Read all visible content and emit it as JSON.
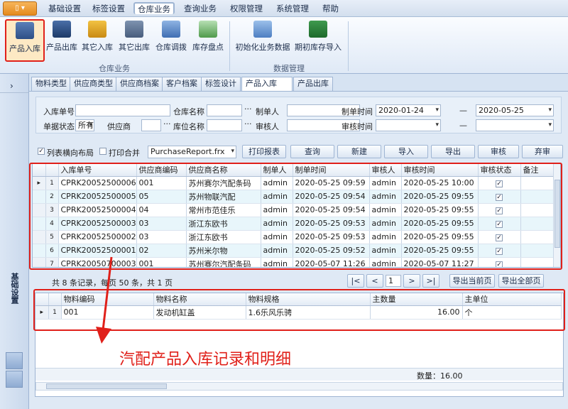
{
  "app_menu_label": "▯ ▾",
  "menu": [
    "基础设置",
    "标签设置",
    "仓库业务",
    "查询业务",
    "权限管理",
    "系统管理",
    "帮助"
  ],
  "ribbon": {
    "warehouse_buttons": [
      "产品入库",
      "产品出库",
      "其它入库",
      "其它出库",
      "仓库调拨",
      "库存盘点"
    ],
    "warehouse_group": "仓库业务",
    "data_buttons": [
      "初始化业务数据",
      "期初库存导入"
    ],
    "data_group": "数据管理"
  },
  "left_panel": {
    "label": "基础设置",
    "toggle": "›"
  },
  "tabs": [
    "物料类型",
    "供应商类型",
    "供应商档案",
    "客户档案",
    "标签设计",
    "产品入库",
    "产品出库"
  ],
  "tab_close": "✕",
  "form": {
    "in_no_label": "入库单号",
    "in_no_value": "",
    "wh_name_label": "仓库名称",
    "wh_name_value": "",
    "maker_label": "制单人",
    "maker_value": "",
    "make_time_label": "制单时间",
    "make_time_from": "2020-01-24",
    "make_time_dash": "—",
    "make_time_to": "2020-05-25",
    "status_label": "单据状态",
    "status_value": "所有",
    "supplier_label": "供应商",
    "supplier_value": "",
    "loc_name_label": "库位名称",
    "loc_name_value": "",
    "auditor_label": "审核人",
    "auditor_value": "",
    "audit_time_label": "审核时间",
    "audit_time_from": "",
    "audit_time_dash": "—",
    "audit_time_to": "",
    "ellipsis": "···"
  },
  "toolbar": {
    "layout_check_label": "列表横向布局",
    "layout_checked": true,
    "merge_check_label": "打印合并",
    "merge_checked": false,
    "report_value": "PurchaseReport.frx",
    "buttons": [
      "打印报表",
      "查询",
      "新建",
      "导入",
      "导出",
      "审核",
      "弃审"
    ]
  },
  "main_grid": {
    "columns": [
      "入库单号",
      "供应商编码",
      "供应商名称",
      "制单人",
      "制单时间",
      "审核人",
      "审核时间",
      "审核状态",
      "备注"
    ],
    "rows": [
      {
        "no": "1",
        "in_no": "CPRK20052500006",
        "sup_code": "001",
        "sup_name": "苏州赛尔汽配条码",
        "maker": "admin",
        "make_time": "2020-05-25 09:59",
        "auditor": "admin",
        "audit_time": "2020-05-25 10:00",
        "checked": "✓"
      },
      {
        "no": "2",
        "in_no": "CPRK20052500005",
        "sup_code": "05",
        "sup_name": "苏州物联汽配",
        "maker": "admin",
        "make_time": "2020-05-25 09:54",
        "auditor": "admin",
        "audit_time": "2020-05-25 09:55",
        "checked": "✓"
      },
      {
        "no": "3",
        "in_no": "CPRK20052500004",
        "sup_code": "04",
        "sup_name": "常州市范佳乐",
        "maker": "admin",
        "make_time": "2020-05-25 09:54",
        "auditor": "admin",
        "audit_time": "2020-05-25 09:55",
        "checked": "✓"
      },
      {
        "no": "4",
        "in_no": "CPRK20052500003",
        "sup_code": "03",
        "sup_name": "浙江东欧书",
        "maker": "admin",
        "make_time": "2020-05-25 09:53",
        "auditor": "admin",
        "audit_time": "2020-05-25 09:55",
        "checked": "✓"
      },
      {
        "no": "5",
        "in_no": "CPRK20052500002",
        "sup_code": "03",
        "sup_name": "浙江东欧书",
        "maker": "admin",
        "make_time": "2020-05-25 09:53",
        "auditor": "admin",
        "audit_time": "2020-05-25 09:55",
        "checked": "✓"
      },
      {
        "no": "6",
        "in_no": "CPRK20052500001",
        "sup_code": "02",
        "sup_name": "苏州米尔物",
        "maker": "admin",
        "make_time": "2020-05-25 09:52",
        "auditor": "admin",
        "audit_time": "2020-05-25 09:55",
        "checked": "✓"
      },
      {
        "no": "7",
        "in_no": "CPRK20050700003",
        "sup_code": "001",
        "sup_name": "苏州赛尔汽配条码",
        "maker": "admin",
        "make_time": "2020-05-07 11:26",
        "auditor": "admin",
        "audit_time": "2020-05-07 11:27",
        "checked": "✓"
      }
    ]
  },
  "pager": {
    "summary": "共 8 条记录，每页 50 条，共 1 页",
    "first": "|<",
    "prev": "<",
    "page": "1",
    "next": ">",
    "last": ">|",
    "export_page": "导出当前页",
    "export_all": "导出全部页"
  },
  "detail_grid": {
    "columns": [
      "物料编码",
      "物料名称",
      "物料规格",
      "主数量",
      "主单位"
    ],
    "rows": [
      {
        "no": "1",
        "code": "001",
        "name": "发动机缸盖",
        "spec": "1.6乐风乐骋",
        "qty": "16.00",
        "unit": "个"
      }
    ],
    "footer": "数量：16.00"
  },
  "annotation": "汽配产品入库记录和明细",
  "colors": {
    "highlight": "#e0201a",
    "alt_row": "#e8f6fb",
    "accent": "#1c2d4a"
  }
}
